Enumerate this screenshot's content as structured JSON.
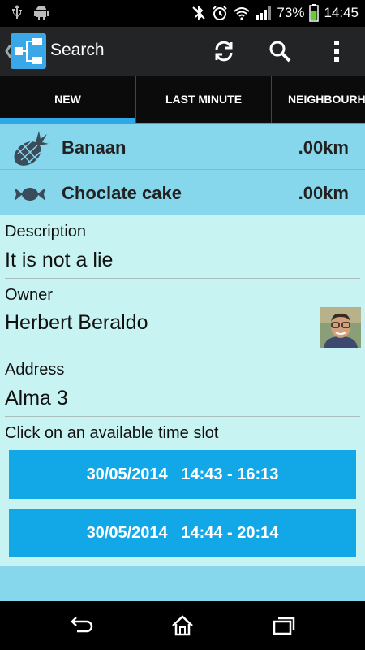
{
  "status_bar": {
    "battery_percent": "73%",
    "time": "14:45"
  },
  "action_bar": {
    "title": "Search"
  },
  "tabs": [
    {
      "label": "NEW",
      "selected": true
    },
    {
      "label": "LAST MINUTE",
      "selected": false
    },
    {
      "label": "NEIGHBOURH",
      "selected": false
    }
  ],
  "items": [
    {
      "icon": "pineapple-icon",
      "name": "Banaan",
      "distance": ".00km"
    },
    {
      "icon": "candy-icon",
      "name": "Choclate cake",
      "distance": ".00km"
    }
  ],
  "details": {
    "description_label": "Description",
    "description_value": "It is not a lie",
    "owner_label": "Owner",
    "owner_value": "Herbert Beraldo",
    "address_label": "Address",
    "address_value": "Alma 3",
    "slots_prompt": "Click on an available time slot"
  },
  "time_slots": [
    "30/05/2014   14:43 - 16:13",
    "30/05/2014   14:44 - 20:14"
  ],
  "colors": {
    "accent": "#2ea8e6",
    "slot_button": "#12a8e8",
    "list_background": "#86d6ec",
    "detail_background": "#c7f4f2"
  }
}
